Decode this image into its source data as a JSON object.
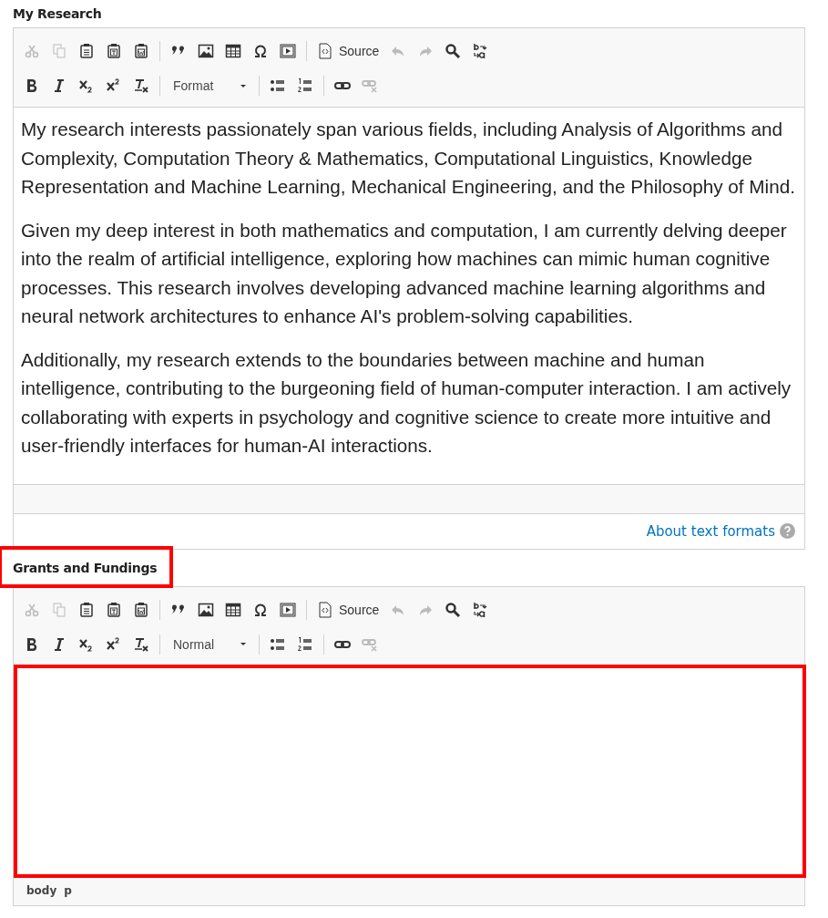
{
  "fields": [
    {
      "label": "My Research",
      "label_highlighted": false,
      "content_highlighted": false,
      "toolbar": [
        [
          {
            "kind": "cut",
            "disabled": true
          },
          {
            "kind": "copy",
            "disabled": true
          },
          {
            "kind": "paste",
            "disabled": false
          },
          {
            "kind": "paste-text",
            "disabled": false
          },
          {
            "kind": "paste-word",
            "disabled": false
          },
          {
            "kind": "sep"
          },
          {
            "kind": "quote",
            "disabled": false
          },
          {
            "kind": "image",
            "disabled": false
          },
          {
            "kind": "table",
            "disabled": false
          },
          {
            "kind": "omega",
            "disabled": false
          },
          {
            "kind": "media",
            "disabled": false
          },
          {
            "kind": "sep"
          },
          {
            "kind": "source",
            "label": "Source",
            "disabled": false
          },
          {
            "kind": "undo",
            "disabled": true
          },
          {
            "kind": "redo",
            "disabled": true
          },
          {
            "kind": "find",
            "disabled": false
          },
          {
            "kind": "replace",
            "disabled": false
          }
        ],
        [
          {
            "kind": "bold",
            "disabled": false
          },
          {
            "kind": "italic",
            "disabled": false
          },
          {
            "kind": "sub",
            "disabled": false
          },
          {
            "kind": "sup",
            "disabled": false
          },
          {
            "kind": "clear",
            "disabled": false
          },
          {
            "kind": "sep"
          },
          {
            "kind": "dropdown",
            "value": "Format"
          },
          {
            "kind": "sep"
          },
          {
            "kind": "bullets",
            "disabled": false
          },
          {
            "kind": "numbers",
            "disabled": false
          },
          {
            "kind": "sep"
          },
          {
            "kind": "link",
            "disabled": false
          },
          {
            "kind": "unlink",
            "disabled": true
          }
        ]
      ],
      "paragraphs": [
        "My research interests passionately span various fields, including Analysis of Algorithms and Complexity, Computation Theory & Mathematics, Computational Linguistics, Knowledge Representation and Machine Learning, Mechanical Engineering, and the Philosophy of Mind.",
        "Given my deep interest in both mathematics and computation, I am currently delving deeper into the realm of artificial intelligence, exploring how machines can mimic human cognitive processes. This research involves developing advanced machine learning algorithms and neural network architectures to enhance AI's problem-solving capabilities.",
        "Additionally, my research extends to the boundaries between machine and human intelligence, contributing to the burgeoning field of human-computer interaction. I am actively collaborating with experts in psychology and cognitive science to create more intuitive and user-friendly interfaces for human-AI interactions."
      ],
      "help_link": "About text formats"
    },
    {
      "label": "Grants and Fundings",
      "label_highlighted": true,
      "content_highlighted": true,
      "toolbar": [
        [
          {
            "kind": "cut",
            "disabled": true
          },
          {
            "kind": "copy",
            "disabled": true
          },
          {
            "kind": "paste",
            "disabled": false
          },
          {
            "kind": "paste-text",
            "disabled": false
          },
          {
            "kind": "paste-word",
            "disabled": false
          },
          {
            "kind": "sep"
          },
          {
            "kind": "quote",
            "disabled": false
          },
          {
            "kind": "image",
            "disabled": false
          },
          {
            "kind": "table",
            "disabled": false
          },
          {
            "kind": "omega",
            "disabled": false
          },
          {
            "kind": "media",
            "disabled": false
          },
          {
            "kind": "sep"
          },
          {
            "kind": "source",
            "label": "Source",
            "disabled": false
          },
          {
            "kind": "undo",
            "disabled": true
          },
          {
            "kind": "redo",
            "disabled": true
          },
          {
            "kind": "find",
            "disabled": false
          },
          {
            "kind": "replace",
            "disabled": false
          }
        ],
        [
          {
            "kind": "bold",
            "disabled": false
          },
          {
            "kind": "italic",
            "disabled": false
          },
          {
            "kind": "sub",
            "disabled": false
          },
          {
            "kind": "sup",
            "disabled": false
          },
          {
            "kind": "clear",
            "disabled": false
          },
          {
            "kind": "sep"
          },
          {
            "kind": "dropdown",
            "value": "Normal"
          },
          {
            "kind": "sep"
          },
          {
            "kind": "bullets",
            "disabled": false
          },
          {
            "kind": "numbers",
            "disabled": false
          },
          {
            "kind": "sep"
          },
          {
            "kind": "link",
            "disabled": false
          },
          {
            "kind": "unlink",
            "disabled": true
          }
        ]
      ],
      "path": [
        "body",
        "p"
      ]
    }
  ]
}
